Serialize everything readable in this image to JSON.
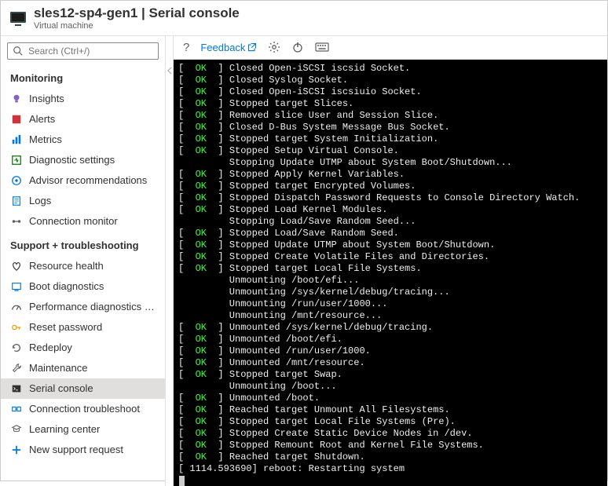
{
  "header": {
    "title": "sles12-sp4-gen1 | Serial console",
    "subtitle": "Virtual machine"
  },
  "search": {
    "placeholder": "Search (Ctrl+/)"
  },
  "sections": {
    "monitoring_title": "Monitoring",
    "support_title": "Support + troubleshooting"
  },
  "monitoring": [
    {
      "label": "Insights",
      "icon": "bulb",
      "color": "#8661c5"
    },
    {
      "label": "Alerts",
      "icon": "alert",
      "color": "#d13438"
    },
    {
      "label": "Metrics",
      "icon": "metrics",
      "color": "#0078d4"
    },
    {
      "label": "Diagnostic settings",
      "icon": "diag",
      "color": "#107c10"
    },
    {
      "label": "Advisor recommendations",
      "icon": "advisor",
      "color": "#0078d4"
    },
    {
      "label": "Logs",
      "icon": "logs",
      "color": "#0078d4"
    },
    {
      "label": "Connection monitor",
      "icon": "conn",
      "color": "#605e5c"
    }
  ],
  "support": [
    {
      "label": "Resource health",
      "icon": "heart",
      "color": "#323130"
    },
    {
      "label": "Boot diagnostics",
      "icon": "boot",
      "color": "#0078d4"
    },
    {
      "label": "Performance diagnostics (P...",
      "icon": "perf",
      "color": "#605e5c"
    },
    {
      "label": "Reset password",
      "icon": "key",
      "color": "#eaa300"
    },
    {
      "label": "Redeploy",
      "icon": "redeploy",
      "color": "#605e5c"
    },
    {
      "label": "Maintenance",
      "icon": "maint",
      "color": "#605e5c"
    },
    {
      "label": "Serial console",
      "icon": "serial",
      "color": "#605e5c",
      "selected": true
    },
    {
      "label": "Connection troubleshoot",
      "icon": "conntr",
      "color": "#0078d4"
    },
    {
      "label": "Learning center",
      "icon": "learn",
      "color": "#605e5c"
    },
    {
      "label": "New support request",
      "icon": "plus",
      "color": "#0078d4"
    }
  ],
  "toolbar": {
    "help": "?",
    "feedback": "Feedback"
  },
  "console_lines": [
    {
      "status": "OK",
      "text": "Closed Open-iSCSI iscsid Socket."
    },
    {
      "status": "OK",
      "text": "Closed Syslog Socket."
    },
    {
      "status": "OK",
      "text": "Closed Open-iSCSI iscsiuio Socket."
    },
    {
      "status": "OK",
      "text": "Stopped target Slices."
    },
    {
      "status": "OK",
      "text": "Removed slice User and Session Slice."
    },
    {
      "status": "OK",
      "text": "Closed D-Bus System Message Bus Socket."
    },
    {
      "status": "OK",
      "text": "Stopped target System Initialization."
    },
    {
      "status": "OK",
      "text": "Stopped Setup Virtual Console."
    },
    {
      "status": "",
      "text": "         Stopping Update UTMP about System Boot/Shutdown..."
    },
    {
      "status": "OK",
      "text": "Stopped Apply Kernel Variables."
    },
    {
      "status": "OK",
      "text": "Stopped target Encrypted Volumes."
    },
    {
      "status": "OK",
      "text": "Stopped Dispatch Password Requests to Console Directory Watch."
    },
    {
      "status": "OK",
      "text": "Stopped Load Kernel Modules."
    },
    {
      "status": "",
      "text": "         Stopping Load/Save Random Seed..."
    },
    {
      "status": "OK",
      "text": "Stopped Load/Save Random Seed."
    },
    {
      "status": "OK",
      "text": "Stopped Update UTMP about System Boot/Shutdown."
    },
    {
      "status": "OK",
      "text": "Stopped Create Volatile Files and Directories."
    },
    {
      "status": "OK",
      "text": "Stopped target Local File Systems."
    },
    {
      "status": "",
      "text": "         Unmounting /boot/efi..."
    },
    {
      "status": "",
      "text": "         Unmounting /sys/kernel/debug/tracing..."
    },
    {
      "status": "",
      "text": "         Unmounting /run/user/1000..."
    },
    {
      "status": "",
      "text": "         Unmounting /mnt/resource..."
    },
    {
      "status": "OK",
      "text": "Unmounted /sys/kernel/debug/tracing."
    },
    {
      "status": "OK",
      "text": "Unmounted /boot/efi."
    },
    {
      "status": "OK",
      "text": "Unmounted /run/user/1000."
    },
    {
      "status": "OK",
      "text": "Unmounted /mnt/resource."
    },
    {
      "status": "OK",
      "text": "Stopped target Swap."
    },
    {
      "status": "",
      "text": "         Unmounting /boot..."
    },
    {
      "status": "OK",
      "text": "Unmounted /boot."
    },
    {
      "status": "OK",
      "text": "Reached target Unmount All Filesystems."
    },
    {
      "status": "OK",
      "text": "Stopped target Local File Systems (Pre)."
    },
    {
      "status": "OK",
      "text": "Stopped Create Static Device Nodes in /dev."
    },
    {
      "status": "OK",
      "text": "Stopped Remount Root and Kernel File Systems."
    },
    {
      "status": "OK",
      "text": "Reached target Shutdown."
    },
    {
      "status": "RAW",
      "text": "[ 1114.593690] reboot: Restarting system"
    }
  ]
}
